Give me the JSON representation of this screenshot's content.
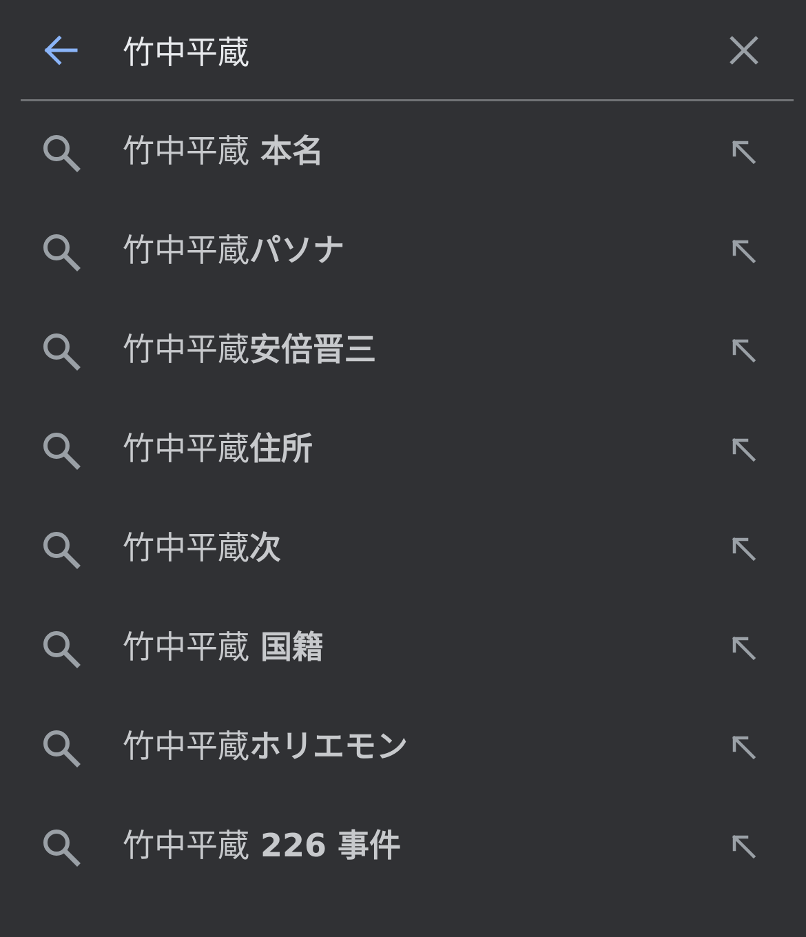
{
  "search": {
    "query": "竹中平蔵",
    "back_icon": "arrow-back-icon",
    "clear_icon": "close-icon",
    "accent_color": "#8ab4f8"
  },
  "suggestions": [
    {
      "query": "竹中平蔵",
      "completion": " 本名"
    },
    {
      "query": "竹中平蔵",
      "completion": "パソナ"
    },
    {
      "query": "竹中平蔵",
      "completion": "安倍晋三"
    },
    {
      "query": "竹中平蔵",
      "completion": "住所"
    },
    {
      "query": "竹中平蔵",
      "completion": "次"
    },
    {
      "query": "竹中平蔵",
      "completion": " 国籍"
    },
    {
      "query": "竹中平蔵",
      "completion": "ホリエモン"
    },
    {
      "query": "竹中平蔵",
      "completion": " 226 事件"
    }
  ],
  "icons": {
    "suggestion_icon": "search-icon",
    "fill_icon": "arrow-up-left-icon"
  },
  "colors": {
    "background": "#303134",
    "text": "#e8eaed",
    "suggestion_text": "#c7c9cc",
    "icon_gray": "#9aa0a6"
  }
}
